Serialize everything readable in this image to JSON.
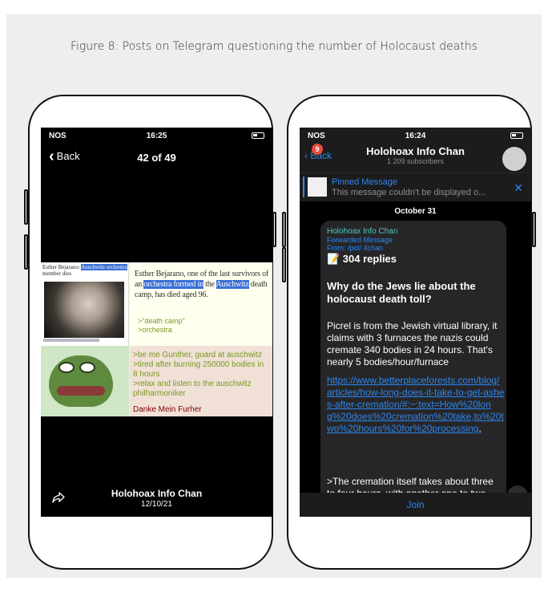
{
  "figure": {
    "caption": "Figure 8: Posts on Telegram questioning the number of Holocaust deaths"
  },
  "left_phone": {
    "status": {
      "carrier": "NOS",
      "time": "16:25"
    },
    "nav": {
      "back_label": "Back",
      "counter": "42 of 49"
    },
    "meme": {
      "article_title_plain": "Esther Bejarano: ",
      "article_title_hl": "Auschwitz orchestra",
      "article_title_tail": " member dies",
      "caption_a": "Esther Bejarano, one of the last survivors of an ",
      "caption_hl1": "orchestra formed in",
      "caption_b": " the ",
      "caption_hl2": "Auschwitz",
      "caption_c": " death camp, has died aged 96.",
      "quote1": ">\"death camp\"",
      "quote2": ">orchestra",
      "green1": ">be me Gunther, guard at auschwitz",
      "green2": ">tired after burning 250000 bodies in 8 hours",
      "green3": ">relax and listen to the auschwitz philharmoniker",
      "red_line": "Danke Mein Furher"
    },
    "footer": {
      "channel": "Holohoax Info Chan",
      "date": "12/10/21"
    },
    "icons": {
      "share": "share-icon"
    }
  },
  "right_phone": {
    "status": {
      "carrier": "NOS",
      "time": "16:24"
    },
    "header": {
      "back_label": "Back",
      "unread": "9",
      "title": "Holohoax Info Chan",
      "subtitle": "1 209 subscribers"
    },
    "pinned": {
      "label": "Pinned Message",
      "text": "This message couldn't be displayed o..."
    },
    "date_sep": "October 31",
    "message": {
      "channel": "Holohoax Info Chan",
      "forwarded": "Forwarded Message",
      "from": "From: /pol/ 4chan",
      "replies": "📝 304 replies",
      "question": "Why do the Jews lie about the holocaust death toll?",
      "para1": "Picrel is from the Jewish virtual library, it claims with 3 furnaces the nazis could cremate 340 bodies in 24 hours. That's nearly 5 bodies/hour/furnace",
      "link": "https://www.betterplaceforests.com/blog/articles/how-long-does-it-take-to-get-ashes-after-cremation/#:~:text=How%20long%20does%20cremation%20take,to%20two%20hours%20for%20processing",
      "link_tail": ".",
      "para2": ">The cremation itself takes about three to four hours, with another one to two"
    },
    "join_label": "Join"
  }
}
